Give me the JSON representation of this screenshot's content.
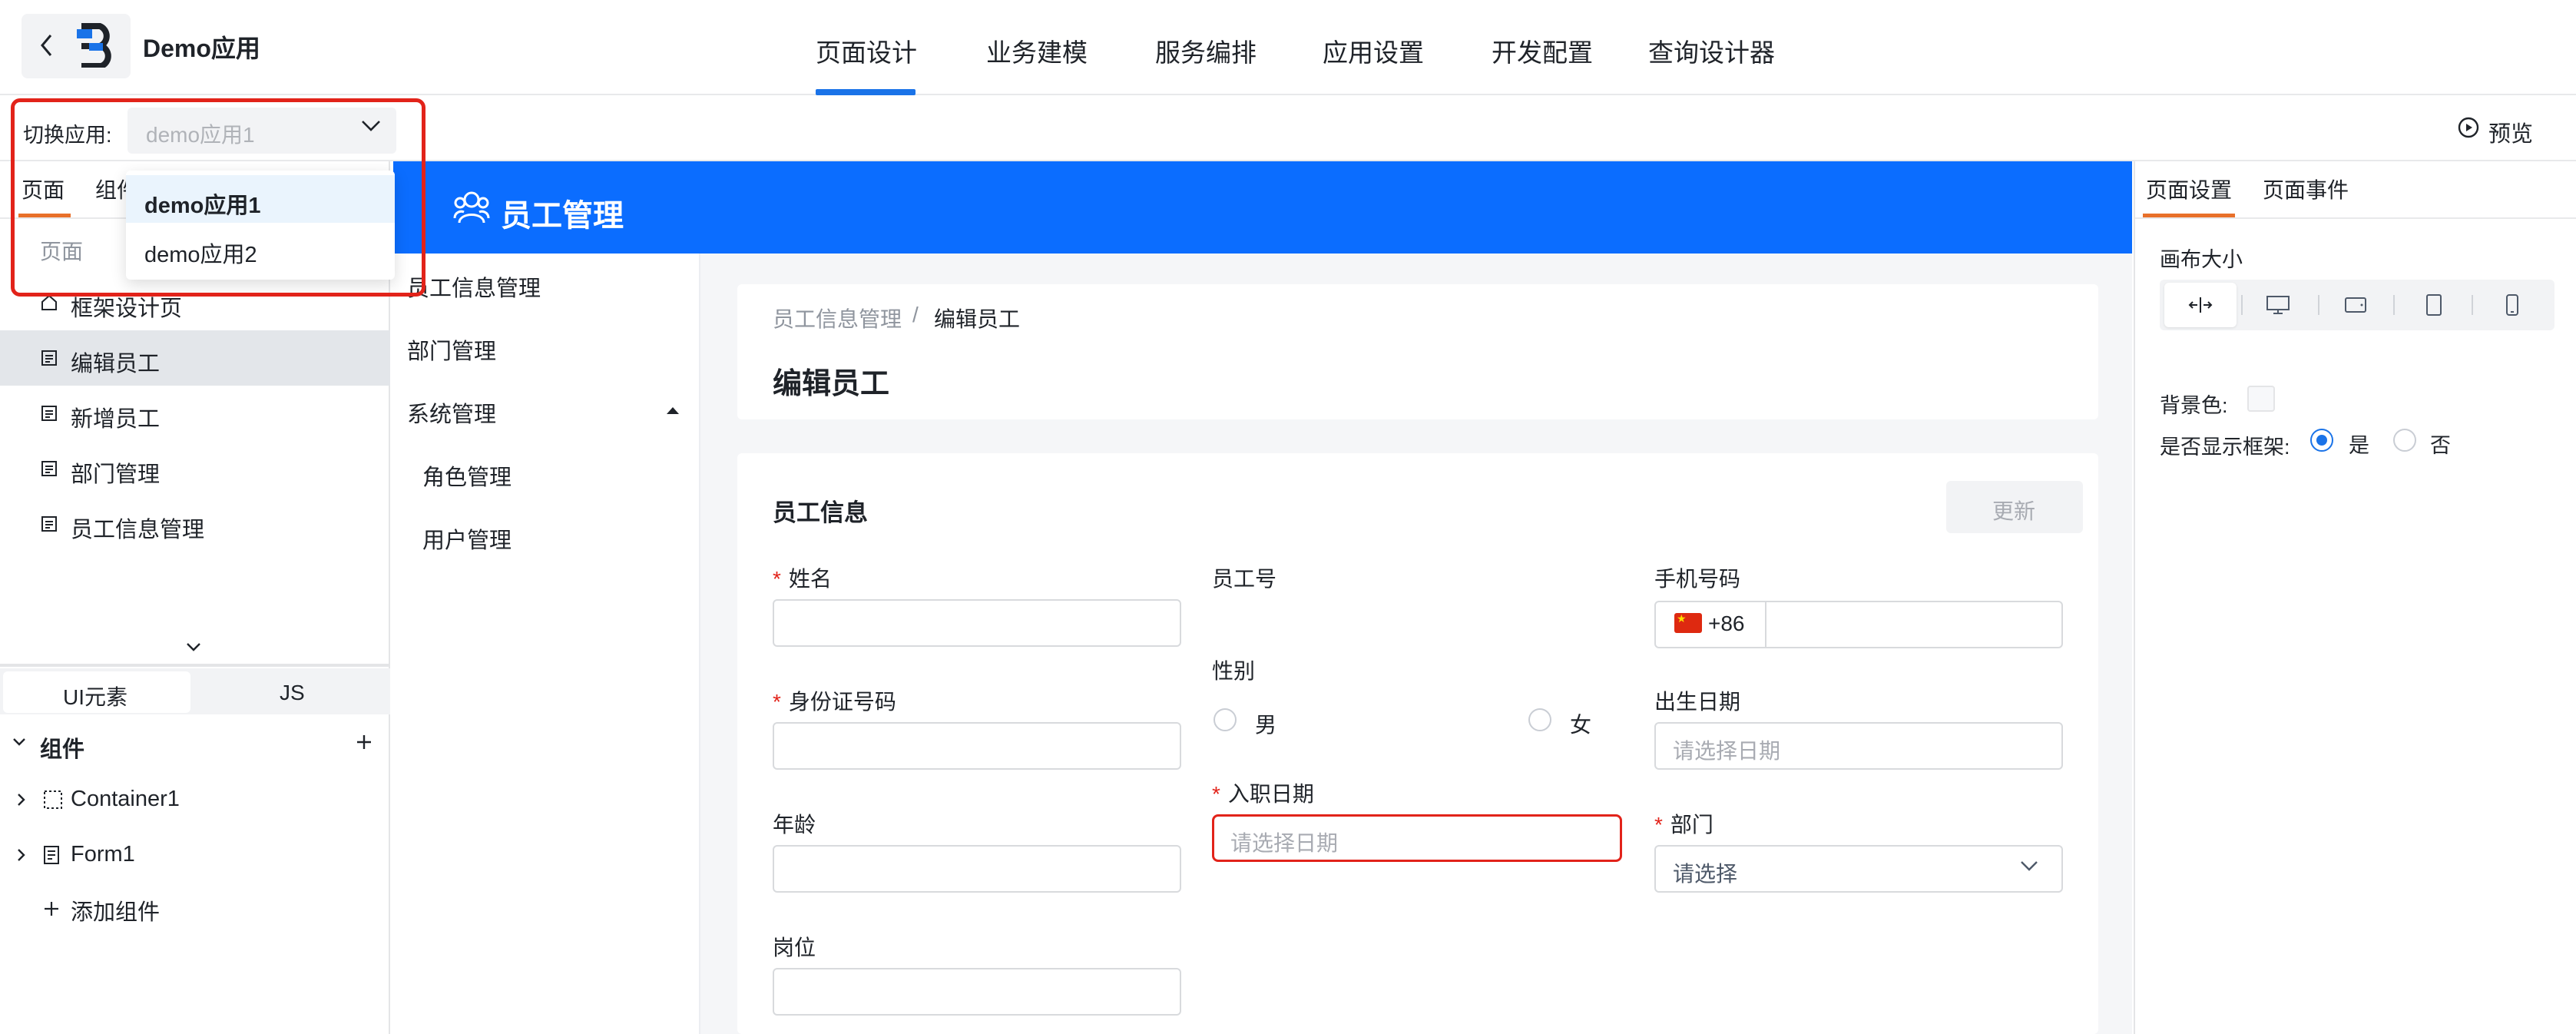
{
  "header": {
    "app_name": "Demo应用",
    "tabs": [
      "页面设计",
      "业务建模",
      "服务编排",
      "应用设置",
      "开发配置",
      "查询设计器"
    ],
    "active_tab": "页面设计",
    "accent_color": "#1a73e8"
  },
  "switch_app": {
    "label": "切换应用:",
    "value": "demo应用1",
    "options": [
      "demo应用1",
      "demo应用2"
    ],
    "selected_option": "demo应用1"
  },
  "preview": {
    "label": "预览"
  },
  "left_panel": {
    "tabs": [
      "页面",
      "组件"
    ],
    "active_tab": "页面",
    "section_label": "页面",
    "pages": [
      {
        "label": "框架设计页",
        "icon": "home-icon",
        "selected": false
      },
      {
        "label": "编辑员工",
        "icon": "page-icon",
        "selected": true
      },
      {
        "label": "新增员工",
        "icon": "page-icon",
        "selected": false
      },
      {
        "label": "部门管理",
        "icon": "page-icon",
        "selected": false
      },
      {
        "label": "员工信息管理",
        "icon": "page-icon",
        "selected": false
      }
    ],
    "segments": [
      "UI元素",
      "JS"
    ],
    "active_segment": "UI元素",
    "tree_title": "组件",
    "tree_items": [
      {
        "label": "Container1",
        "icon": "container-icon"
      },
      {
        "label": "Form1",
        "icon": "form-icon"
      }
    ],
    "add_component": "添加组件"
  },
  "canvas": {
    "header_title": "员工管理",
    "header_color": "#0b6dff",
    "nav": [
      {
        "label": "员工信息管理"
      },
      {
        "label": "部门管理"
      },
      {
        "label": "系统管理",
        "expanded": true
      },
      {
        "label": "角色管理",
        "child": true
      },
      {
        "label": "用户管理",
        "child": true
      }
    ],
    "breadcrumb": [
      "员工信息管理",
      "/",
      "编辑员工"
    ],
    "page_title": "编辑员工",
    "section_title": "员工信息",
    "update_button": "更新",
    "fields": {
      "name": {
        "label": "姓名",
        "required": "*"
      },
      "employee_no": {
        "label": "员工号"
      },
      "phone": {
        "label": "手机号码",
        "prefix": "+86"
      },
      "id_card": {
        "label": "身份证号码",
        "required": "*"
      },
      "gender": {
        "label": "性别",
        "options": [
          "男",
          "女"
        ]
      },
      "birth": {
        "label": "出生日期",
        "placeholder": "请选择日期"
      },
      "join_date": {
        "label": "入职日期",
        "required": "*",
        "placeholder": "请选择日期"
      },
      "age": {
        "label": "年龄"
      },
      "dept": {
        "label": "部门",
        "required": "*",
        "placeholder": "请选择"
      },
      "position": {
        "label": "岗位"
      }
    }
  },
  "right_panel": {
    "tabs": [
      "页面设置",
      "页面事件"
    ],
    "active_tab": "页面设置",
    "canvas_size_label": "画布大小",
    "size_options": [
      "auto-width-icon",
      "desktop-icon",
      "tablet-landscape-icon",
      "tablet-portrait-icon",
      "phone-icon"
    ],
    "bg_label": "背景色:",
    "frame_label": "是否显示框架:",
    "frame_options": [
      "是",
      "否"
    ],
    "frame_selected": "是"
  }
}
